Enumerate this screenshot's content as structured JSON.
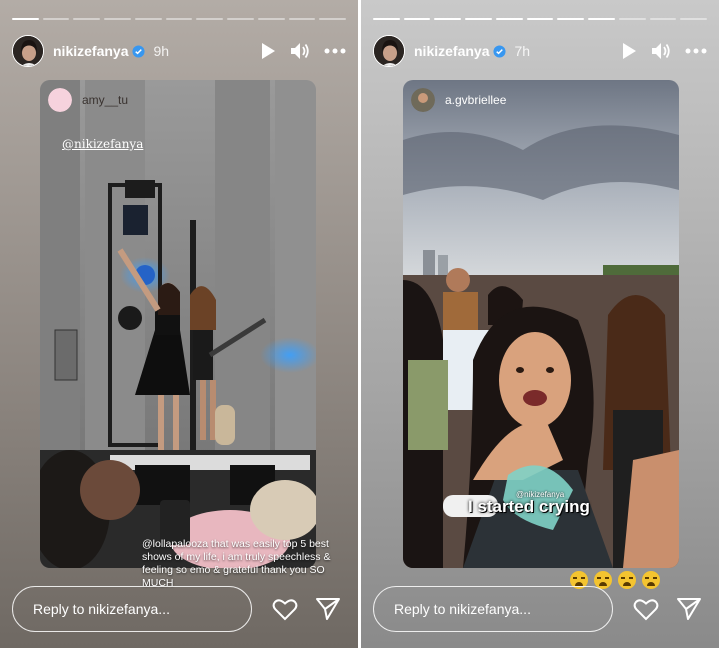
{
  "stories": [
    {
      "progress_done": 1,
      "progress_total": 11,
      "author": {
        "username": "nikizefanya",
        "time": "9h"
      },
      "repost": {
        "username": "amy__tu",
        "mention": "@nikizefanya",
        "caption": "@lollapalooza that was easily top 5 best shows of my life, i am truly speechless & feeling so emo & grateful thank you SO MUCH"
      },
      "reply": {
        "placeholder": "Reply to nikizefanya..."
      },
      "icons": [
        "play-icon",
        "volume-icon",
        "more-icon",
        "heart-icon",
        "send-icon"
      ]
    },
    {
      "progress_done": 8,
      "progress_total": 11,
      "author": {
        "username": "nikizefanya",
        "time": "7h"
      },
      "repost": {
        "username": "a.gvbriellee",
        "sticker_handle": "@nikizefanya",
        "sticker_text": "I started crying"
      },
      "emoji_count": 4,
      "reply": {
        "placeholder": "Reply to nikizefanya..."
      },
      "icons": [
        "play-icon",
        "volume-icon",
        "more-icon",
        "heart-icon",
        "send-icon"
      ]
    }
  ],
  "colors": {
    "verified": "#3897f0",
    "text": "#ffffff"
  }
}
